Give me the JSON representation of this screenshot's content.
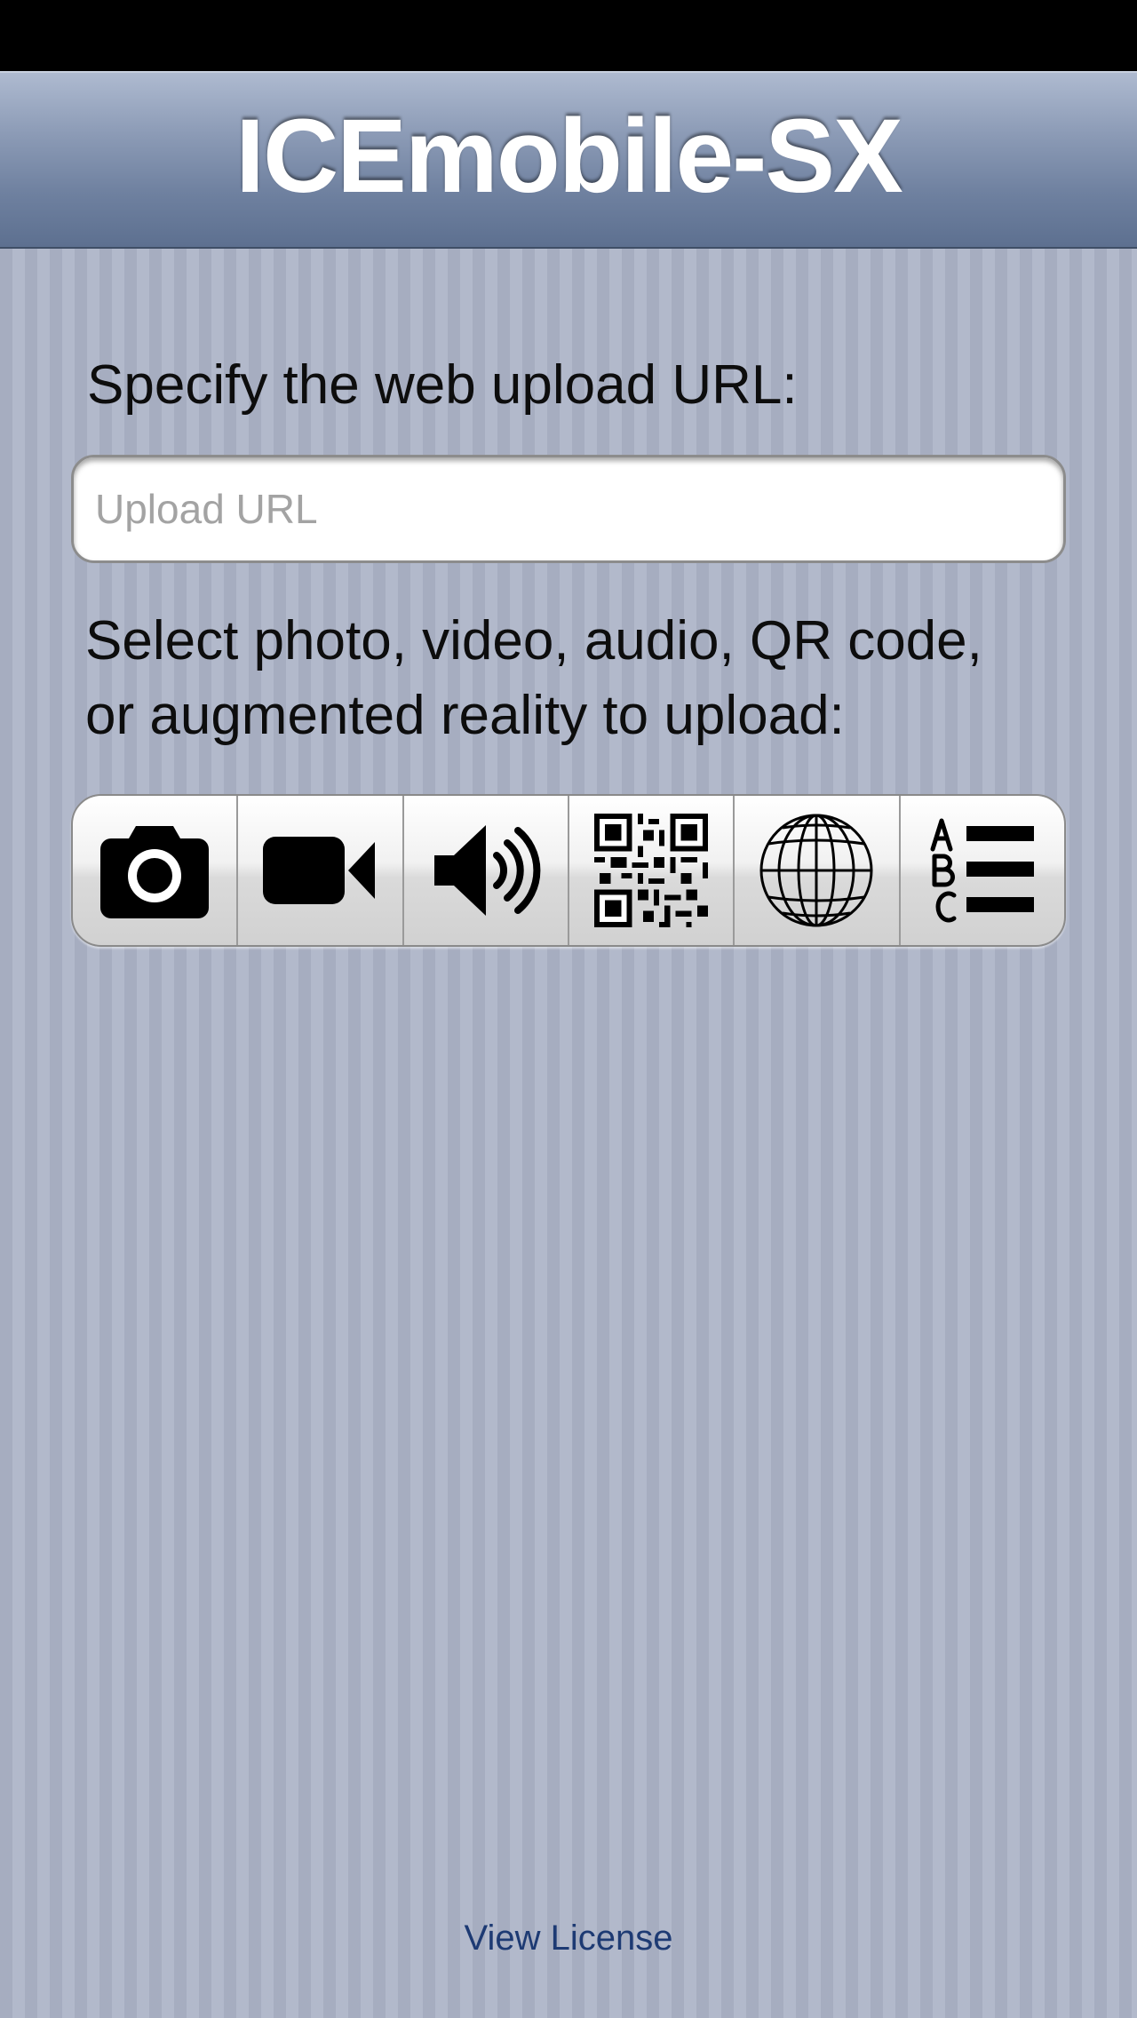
{
  "nav": {
    "title": "ICEmobile-SX"
  },
  "upload": {
    "label": "Specify the web upload URL:",
    "placeholder": "Upload URL",
    "value": ""
  },
  "select": {
    "line1": "Select photo, video, audio, QR code,",
    "line2": "or augmented reality to upload:"
  },
  "buttons": [
    {
      "name": "camera-button",
      "icon": "camera-icon"
    },
    {
      "name": "video-button",
      "icon": "video-camera-icon"
    },
    {
      "name": "audio-button",
      "icon": "speaker-icon"
    },
    {
      "name": "qr-code-button",
      "icon": "qr-code-icon"
    },
    {
      "name": "augmented-reality-button",
      "icon": "globe-icon"
    },
    {
      "name": "list-button",
      "icon": "abc-list-icon"
    }
  ],
  "footer": {
    "license_link": "View License"
  },
  "colors": {
    "nav_bar": "#6e809f",
    "background_stripe_dark": "#a6adc0",
    "background_stripe_light": "#b2b9cb",
    "link": "#1d3a73"
  }
}
